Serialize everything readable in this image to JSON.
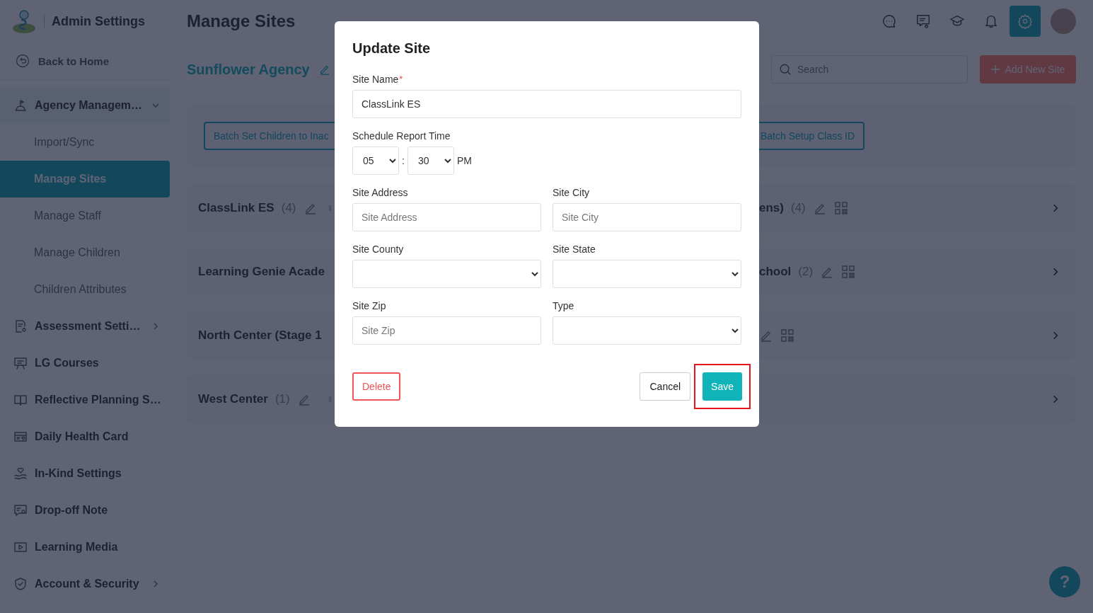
{
  "app": {
    "title": "Admin Settings",
    "back_link": "Back to Home"
  },
  "sidebar": {
    "items": [
      {
        "label": "Agency Managem…",
        "expanded": true,
        "children": [
          {
            "label": "Import/Sync",
            "selected": false
          },
          {
            "label": "Manage Sites",
            "selected": true
          },
          {
            "label": "Manage Staff",
            "selected": false
          },
          {
            "label": "Manage Children",
            "selected": false
          },
          {
            "label": "Children Attributes",
            "selected": false
          }
        ]
      },
      {
        "label": "Assessment Setti…",
        "expanded": false
      },
      {
        "label": "LG Courses"
      },
      {
        "label": "Reflective Planning S…"
      },
      {
        "label": "Daily Health Card"
      },
      {
        "label": "In-Kind Settings"
      },
      {
        "label": "Drop-off Note"
      },
      {
        "label": "Learning Media"
      },
      {
        "label": "Account & Security",
        "expanded": false
      }
    ]
  },
  "header": {
    "page_title": "Manage Sites",
    "toolbar": [
      {
        "selected": false
      },
      {
        "selected": false
      },
      {
        "selected": false
      },
      {
        "selected": false
      },
      {
        "selected": true
      }
    ]
  },
  "agency": {
    "name": "Sunflower Agency",
    "search": {
      "placeholder": "Search"
    },
    "add_button": "Add New Site"
  },
  "batch_buttons": [
    "Batch Set Children to Inac",
    "Batch Setup Class ID"
  ],
  "sites": [
    {
      "left": {
        "name": "ClassLink ES",
        "count": "(4)",
        "actions": true
      },
      "right": {
        "name": "ens)",
        "count": "(4)",
        "actions": true
      }
    },
    {
      "left": {
        "name": "Learning Genie Acade",
        "actions": false
      },
      "right": {
        "name": "chool",
        "count": "(2)",
        "actions": true
      }
    },
    {
      "left": {
        "name": "North Center (Stage 1",
        "actions": false
      },
      "right": {
        "actions": true
      }
    },
    {
      "left": {
        "name": "West Center",
        "count": "(1)",
        "actions": true
      },
      "right": {
        "actions": false
      }
    }
  ],
  "dialog": {
    "title": "Update Site",
    "rows": [
      [
        {
          "kind": "text",
          "label": "Site Name",
          "required_mark": "*",
          "value": "ClassLink ES"
        }
      ],
      [
        {
          "kind": "time",
          "label": "Schedule Report Time",
          "hour": "05",
          "separator": ":",
          "minute": "30",
          "period": "PM"
        }
      ],
      [
        {
          "kind": "text",
          "label": "Site Address",
          "placeholder": "Site Address"
        },
        {
          "kind": "text",
          "label": "Site City",
          "placeholder": "Site City"
        }
      ],
      [
        {
          "kind": "select",
          "label": "Site County"
        },
        {
          "kind": "select",
          "label": "Site State"
        }
      ],
      [
        {
          "kind": "text",
          "label": "Site Zip",
          "placeholder": "Site Zip"
        },
        {
          "kind": "select",
          "label": "Type"
        }
      ]
    ],
    "delete_button": "Delete",
    "cancel_button": "Cancel",
    "save_button": "Save"
  },
  "help_button": "?"
}
